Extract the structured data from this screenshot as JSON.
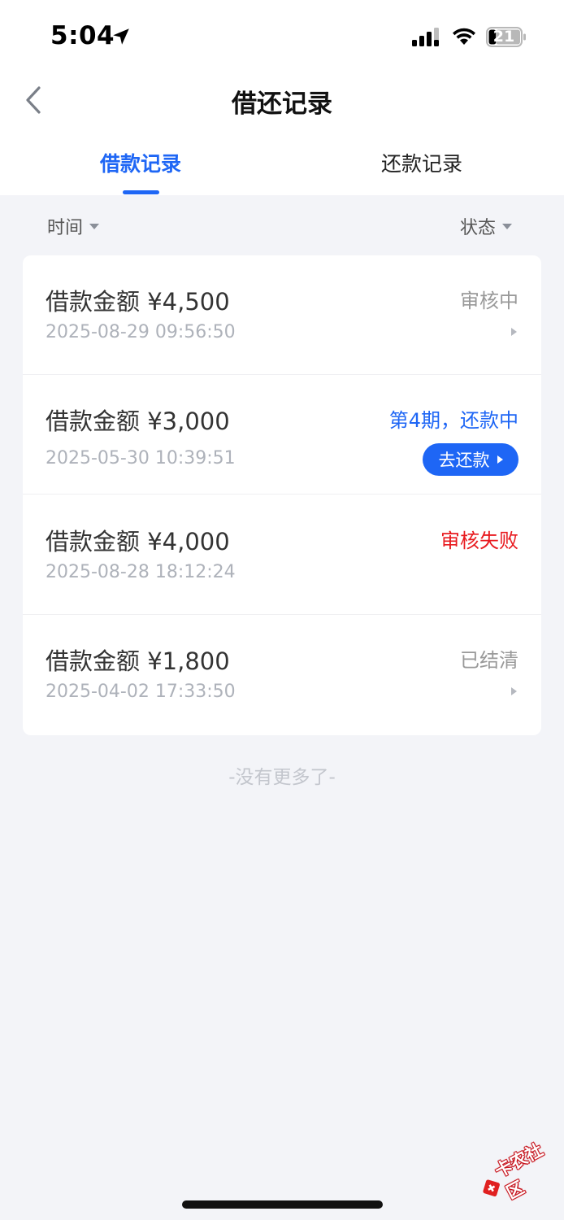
{
  "status_bar": {
    "time": "5:04",
    "battery": "21"
  },
  "nav": {
    "title": "借还记录"
  },
  "tabs": [
    {
      "label": "借款记录",
      "active": true
    },
    {
      "label": "还款记录",
      "active": false
    }
  ],
  "filters": {
    "time_label": "时间",
    "status_label": "状态"
  },
  "records": [
    {
      "amount": "借款金额 ¥4,500",
      "date": "2025-08-29 09:56:50",
      "status": "审核中"
    },
    {
      "amount": "借款金额 ¥3,000",
      "date": "2025-05-30 10:39:51",
      "status": "第4期，还款中",
      "action": "去还款"
    },
    {
      "amount": "借款金额 ¥4,000",
      "date": "2025-08-28 18:12:24",
      "status": "审核失败"
    },
    {
      "amount": "借款金额 ¥1,800",
      "date": "2025-04-02 17:33:50",
      "status": "已结清"
    }
  ],
  "footer": {
    "no_more": "-没有更多了-"
  },
  "watermark": {
    "text": "卡农社区"
  },
  "colors": {
    "accent": "#1e66f5",
    "danger": "#e8191e",
    "background": "#f3f4f8"
  }
}
